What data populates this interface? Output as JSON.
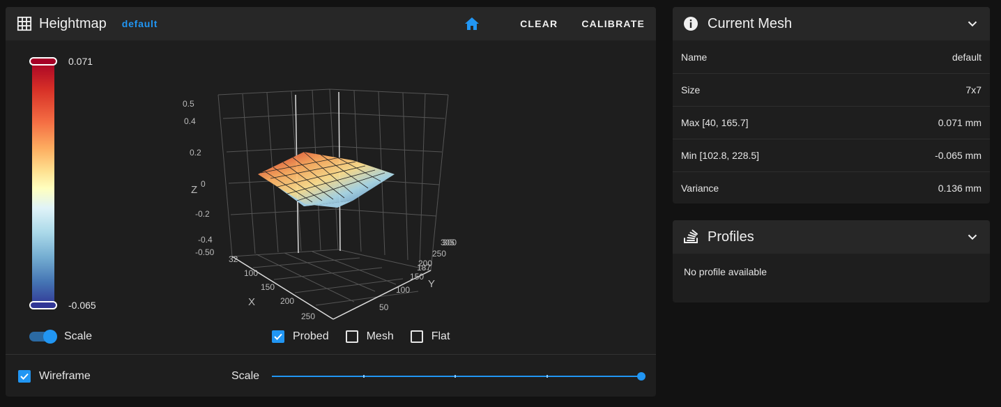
{
  "heightmap": {
    "title": "Heightmap",
    "profile_badge": "default",
    "clear_label": "CLEAR",
    "calibrate_label": "CALIBRATE",
    "colorbar": {
      "max": "0.071",
      "min": "-0.065"
    },
    "scale_switch_label": "Scale",
    "toggles": [
      {
        "label": "Probed",
        "checked": true
      },
      {
        "label": "Mesh",
        "checked": false
      },
      {
        "label": "Flat",
        "checked": false
      }
    ],
    "wireframe_label": "Wireframe",
    "scale_slider_label": "Scale",
    "accent_color": "#2196f3"
  },
  "plot": {
    "z_axis_label": "Z",
    "x_axis_label": "X",
    "y_axis_label": "Y",
    "z_ticks": [
      "0.5",
      "0.4",
      "0.2",
      "0",
      "-0.2",
      "-0.4",
      "-0.50"
    ],
    "x_ticks": [
      "32",
      "100",
      "150",
      "200",
      "250"
    ],
    "y_ticks": [
      "305",
      "300",
      "250",
      "187",
      "200",
      "150",
      "100",
      "50"
    ]
  },
  "mesh": {
    "title": "Current Mesh",
    "rows": [
      {
        "label": "Name",
        "value": "default"
      },
      {
        "label": "Size",
        "value": "7x7"
      },
      {
        "label": "Max [40, 165.7]",
        "value": "0.071 mm"
      },
      {
        "label": "Min [102.8, 228.5]",
        "value": "-0.065 mm"
      },
      {
        "label": "Variance",
        "value": "0.136 mm"
      }
    ]
  },
  "profiles": {
    "title": "Profiles",
    "empty_text": "No profile available"
  }
}
